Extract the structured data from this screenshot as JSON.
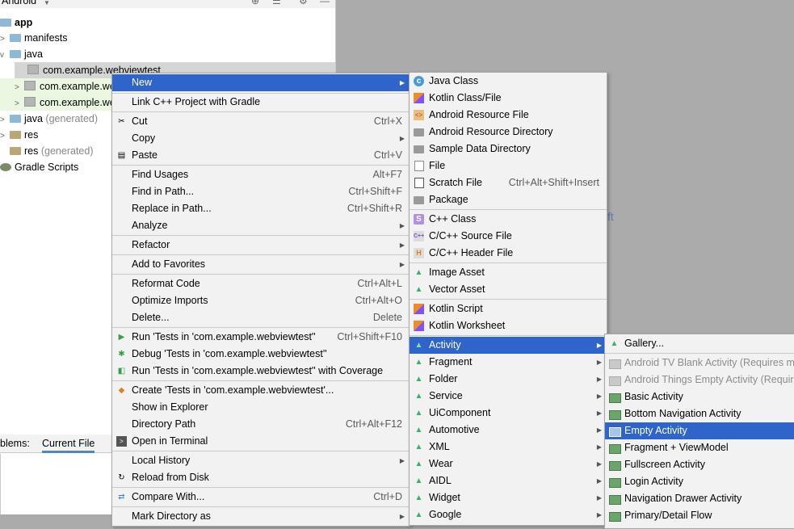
{
  "project_panel": {
    "view_selector": "Android",
    "tree": [
      {
        "label": "app",
        "bold": true
      },
      {
        "label": "manifests"
      },
      {
        "label": "java"
      },
      {
        "label": "com.example.webviewtest",
        "selected": true
      },
      {
        "label": "com.example.we"
      },
      {
        "label": "com.example.we"
      },
      {
        "label": "java",
        "suffix": "(generated)"
      },
      {
        "label": "res"
      },
      {
        "label": "res",
        "suffix": "(generated)"
      },
      {
        "label": "Gradle Scripts"
      }
    ],
    "bottom_tabs": [
      "blems:",
      "Current File"
    ]
  },
  "editor_hint": "ft",
  "context_menu": [
    {
      "label": "New",
      "submenu": true,
      "highlighted": true
    },
    {
      "label": "Link C++ Project with Gradle"
    },
    {
      "label": "Cut",
      "shortcut": "Ctrl+X",
      "icon": "scissors-icon"
    },
    {
      "label": "Copy",
      "submenu": true
    },
    {
      "label": "Paste",
      "shortcut": "Ctrl+V",
      "icon": "clipboard-icon"
    },
    {
      "label": "Find Usages",
      "shortcut": "Alt+F7"
    },
    {
      "label": "Find in Path...",
      "shortcut": "Ctrl+Shift+F"
    },
    {
      "label": "Replace in Path...",
      "shortcut": "Ctrl+Shift+R"
    },
    {
      "label": "Analyze",
      "submenu": true
    },
    {
      "label": "Refactor",
      "submenu": true
    },
    {
      "label": "Add to Favorites",
      "submenu": true
    },
    {
      "label": "Reformat Code",
      "shortcut": "Ctrl+Alt+L"
    },
    {
      "label": "Optimize Imports",
      "shortcut": "Ctrl+Alt+O"
    },
    {
      "label": "Delete...",
      "shortcut": "Delete"
    },
    {
      "label": "Run 'Tests in 'com.example.webviewtest''",
      "shortcut": "Ctrl+Shift+F10",
      "icon": "run-icon"
    },
    {
      "label": "Debug 'Tests in 'com.example.webviewtest''",
      "icon": "debug-icon"
    },
    {
      "label": "Run 'Tests in 'com.example.webviewtest'' with Coverage",
      "icon": "coverage-icon"
    },
    {
      "label": "Create 'Tests in 'com.example.webviewtest'...",
      "icon": "create-test-icon"
    },
    {
      "label": "Show in Explorer"
    },
    {
      "label": "Directory Path",
      "shortcut": "Ctrl+Alt+F12"
    },
    {
      "label": "Open in Terminal",
      "icon": "terminal-icon"
    },
    {
      "label": "Local History",
      "submenu": true
    },
    {
      "label": "Reload from Disk",
      "icon": "reload-icon"
    },
    {
      "label": "Compare With...",
      "shortcut": "Ctrl+D",
      "icon": "compare-icon"
    },
    {
      "label": "Mark Directory as",
      "submenu": true
    }
  ],
  "new_submenu": [
    {
      "label": "Java Class",
      "icon": "java-class-icon"
    },
    {
      "label": "Kotlin Class/File",
      "icon": "kotlin-icon"
    },
    {
      "label": "Android Resource File",
      "icon": "resource-file-icon"
    },
    {
      "label": "Android Resource Directory",
      "icon": "folder-icon"
    },
    {
      "label": "Sample Data Directory",
      "icon": "folder-icon"
    },
    {
      "label": "File",
      "icon": "file-icon"
    },
    {
      "label": "Scratch File",
      "shortcut": "Ctrl+Alt+Shift+Insert",
      "icon": "scratch-file-icon"
    },
    {
      "label": "Package",
      "icon": "package-icon"
    },
    {
      "label": "C++ Class",
      "icon": "cpp-class-icon"
    },
    {
      "label": "C/C++ Source File",
      "icon": "cpp-source-icon"
    },
    {
      "label": "C/C++ Header File",
      "icon": "cpp-header-icon"
    },
    {
      "label": "Image Asset",
      "icon": "android-icon"
    },
    {
      "label": "Vector Asset",
      "icon": "android-icon"
    },
    {
      "label": "Kotlin Script",
      "icon": "kotlin-icon"
    },
    {
      "label": "Kotlin Worksheet",
      "icon": "kotlin-icon"
    },
    {
      "label": "Activity",
      "submenu": true,
      "highlighted": true,
      "icon": "android-icon"
    },
    {
      "label": "Fragment",
      "submenu": true,
      "icon": "android-icon"
    },
    {
      "label": "Folder",
      "submenu": true,
      "icon": "android-icon"
    },
    {
      "label": "Service",
      "submenu": true,
      "icon": "android-icon"
    },
    {
      "label": "UiComponent",
      "submenu": true,
      "icon": "android-icon"
    },
    {
      "label": "Automotive",
      "submenu": true,
      "icon": "android-icon"
    },
    {
      "label": "XML",
      "submenu": true,
      "icon": "android-icon"
    },
    {
      "label": "Wear",
      "submenu": true,
      "icon": "android-icon"
    },
    {
      "label": "AIDL",
      "submenu": true,
      "icon": "android-icon"
    },
    {
      "label": "Widget",
      "submenu": true,
      "icon": "android-icon"
    },
    {
      "label": "Google",
      "submenu": true,
      "icon": "android-icon"
    }
  ],
  "activity_submenu": [
    {
      "label": "Gallery...",
      "icon": "android-icon"
    },
    {
      "label": "Android TV Blank Activity (Requires mi",
      "disabled": true
    },
    {
      "label": "Android Things Empty Activity (Require",
      "disabled": true
    },
    {
      "label": "Basic Activity"
    },
    {
      "label": "Bottom Navigation Activity"
    },
    {
      "label": "Empty Activity",
      "highlighted": true
    },
    {
      "label": "Fragment + ViewModel"
    },
    {
      "label": "Fullscreen Activity"
    },
    {
      "label": "Login Activity"
    },
    {
      "label": "Navigation Drawer Activity"
    },
    {
      "label": "Primary/Detail Flow"
    }
  ]
}
